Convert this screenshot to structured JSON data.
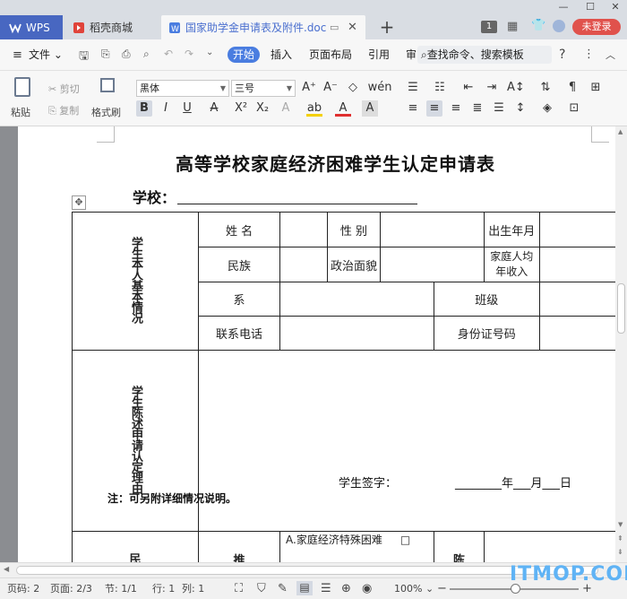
{
  "tabs": {
    "wps": "WPS",
    "daoke": "稻壳商城",
    "doc": "国家助学金申请表及附件.doc"
  },
  "window": {
    "count_badge": "1",
    "login": "未登录"
  },
  "menubar": {
    "file": "文件",
    "start": "开始",
    "insert": "插入",
    "layout": "页面布局",
    "reference": "引用",
    "review": "审",
    "search": "查找命令、搜索模板"
  },
  "ribbon": {
    "paste": "粘贴",
    "cut": "剪切",
    "copy": "复制",
    "format_painter": "格式刷",
    "font": "黑体",
    "size": "三号"
  },
  "document": {
    "title": "高等学校家庭经济困难学生认定申请表",
    "school_label": "学校：",
    "section1": "学生本人基本情况",
    "cells": {
      "name": "姓 名",
      "gender": "性 别",
      "birth": "出生年月",
      "ethnic": "民族",
      "politics": "政治面貌",
      "income": "家庭人均年收入",
      "dept": "系",
      "class": "班级",
      "phone": "联系电话",
      "idcard": "身份证号码"
    },
    "section2": "学生陈述申请认定理由",
    "signature": "学生签字：",
    "date_line": "________年___月___日",
    "note": "注：可另附详细情况说明。",
    "option_a": "A.家庭经济特殊困难",
    "checkbox": "□",
    "partial_left": "民",
    "partial_mid": "推",
    "partial_right": "陈"
  },
  "status": {
    "page_no": "页码: 2",
    "pages": "页面: 2/3",
    "section": "节: 1/1",
    "row": "行: 1",
    "col": "列: 1",
    "zoom": "100%"
  },
  "watermark": "ITMOP.COM"
}
